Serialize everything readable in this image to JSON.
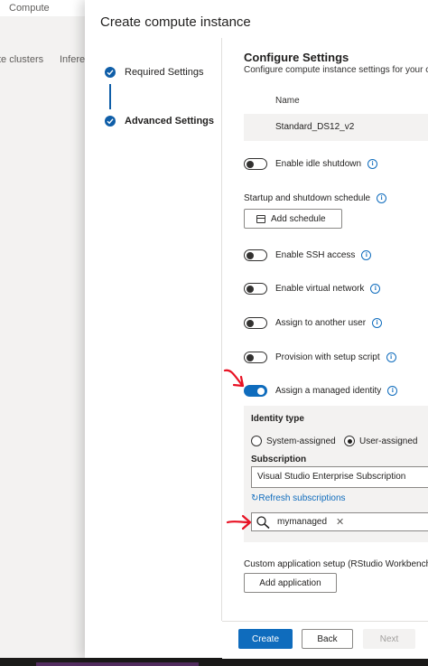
{
  "background": {
    "title": "Compute",
    "tabs": [
      "te clusters",
      "Inferer"
    ]
  },
  "panel": {
    "title": "Create compute instance",
    "steps": [
      {
        "label": "Required Settings",
        "status": "complete"
      },
      {
        "label": "Advanced Settings",
        "status": "complete-current"
      }
    ]
  },
  "configure": {
    "title": "Configure Settings",
    "subtitle": "Configure compute instance settings for your c",
    "name_header": "Name",
    "vm_size": "Standard_DS12_v2"
  },
  "toggles": [
    {
      "label": "Enable idle shutdown",
      "on": false
    },
    {
      "label": "Enable SSH access",
      "on": false
    },
    {
      "label": "Enable virtual network",
      "on": false
    },
    {
      "label": "Assign to another user",
      "on": false
    },
    {
      "label": "Provision with setup script",
      "on": false
    },
    {
      "label": "Assign a managed identity",
      "on": true
    }
  ],
  "schedule": {
    "label": "Startup and shutdown schedule",
    "button": "Add schedule"
  },
  "managed_identity": {
    "identity_type_label": "Identity type",
    "options": [
      "System-assigned",
      "User-assigned"
    ],
    "selected": "User-assigned",
    "subscription_label": "Subscription",
    "subscription_value": "Visual Studio Enterprise Subscription",
    "refresh_link": "Refresh subscriptions",
    "identity_value": "mymanaged",
    "remove_glyph": "✕"
  },
  "custom_app": {
    "label": "Custom application setup (RStudio Workbench",
    "button": "Add application"
  },
  "footer": {
    "create": "Create",
    "back": "Back",
    "next": "Next"
  },
  "icons": {
    "step_check": "check-circle-icon",
    "info": "info-icon",
    "calendar": "calendar-icon",
    "refresh": "refresh-icon",
    "search": "search-icon",
    "annotation": "red-arrow-icon"
  },
  "colors": {
    "accent": "#0f6cbd",
    "step": "#0f5ea8",
    "annotation": "#e81123"
  }
}
